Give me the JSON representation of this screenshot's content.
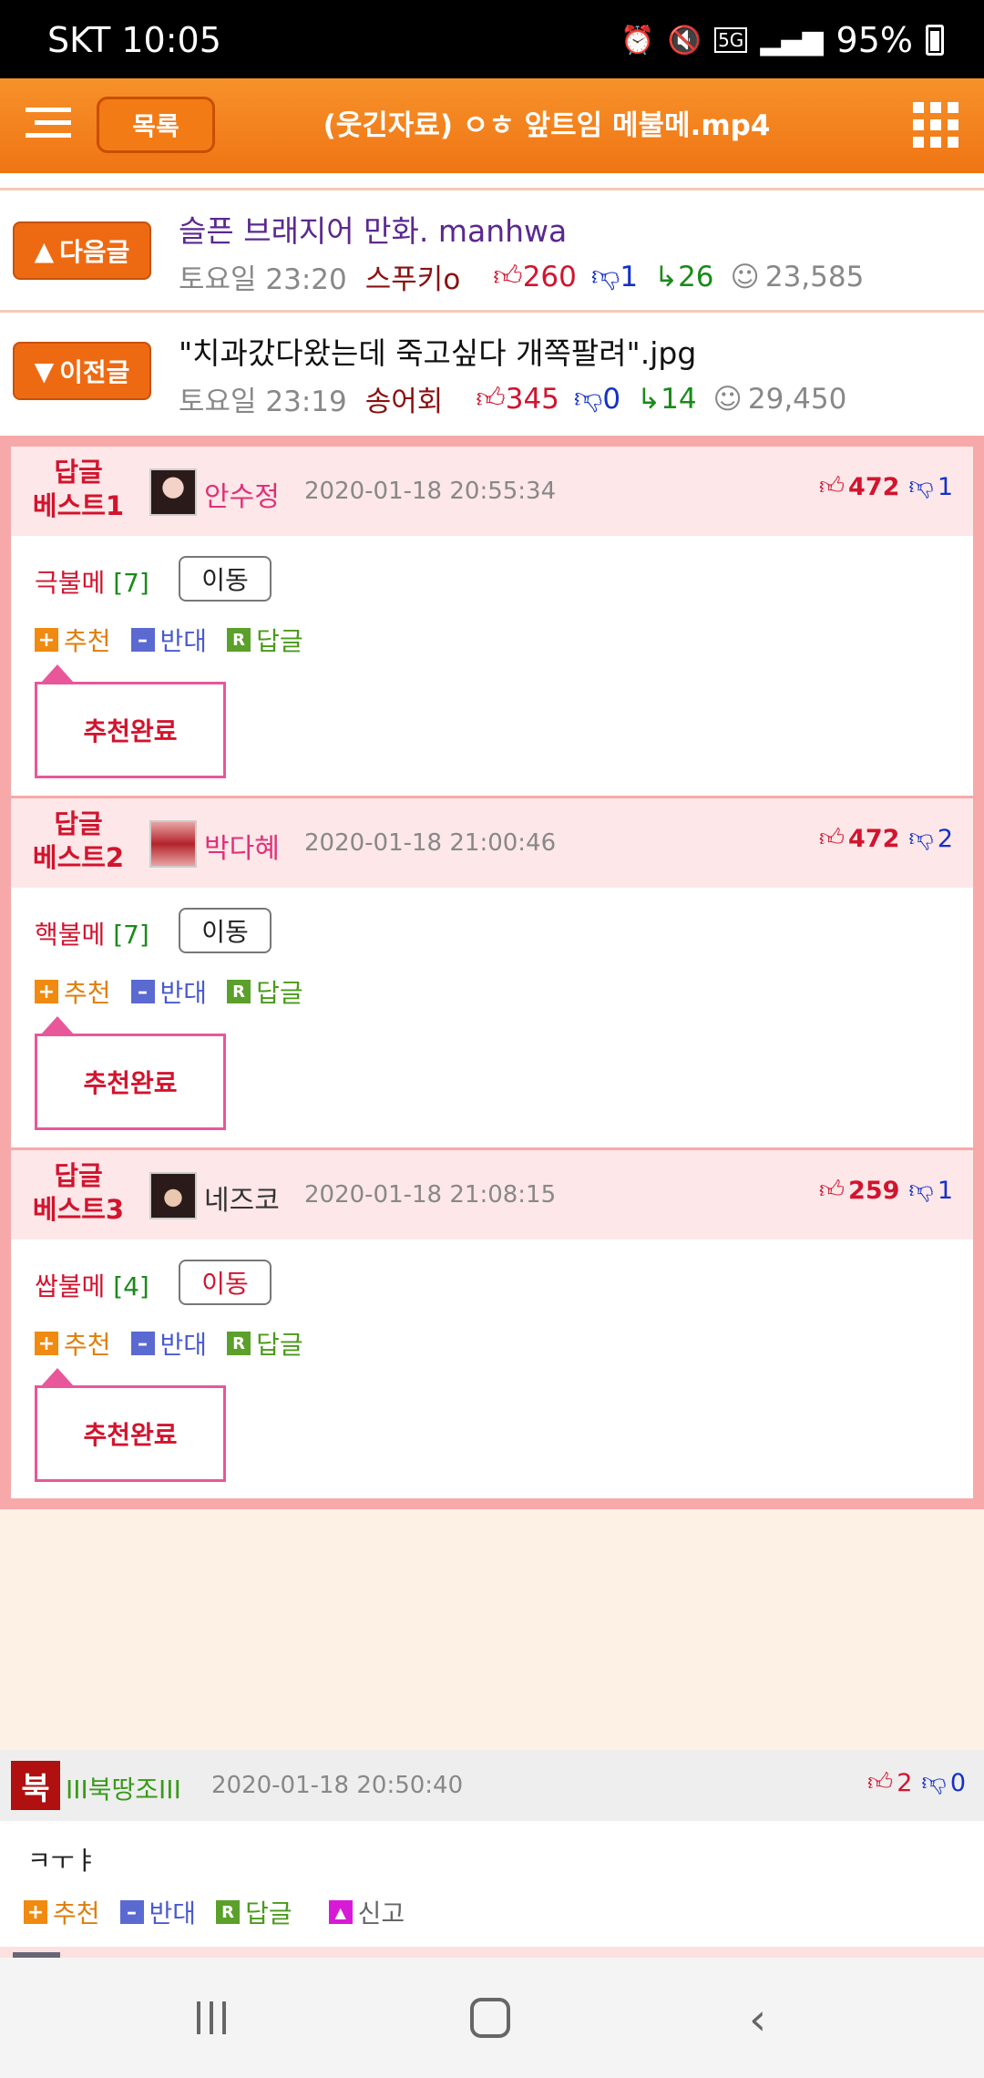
{
  "status_bar": {
    "carrier_time": "SKT 10:05",
    "battery": "95%",
    "network": "5G"
  },
  "header": {
    "list_button": "목록",
    "title": "(웃긴자료) ㅇㅎ 앞트임 메불메.mp4",
    "menu_icon": "hamburger-menu-icon",
    "grid_icon": "grid-apps-icon"
  },
  "nav": {
    "next": {
      "button": "다음글",
      "title": "슬픈 브래지어 만화. manhwa",
      "time": "토요일 23:20",
      "author": "스푸키o",
      "up": "260",
      "down": "1",
      "replies": "26",
      "views": "23,585"
    },
    "prev": {
      "button": "이전글",
      "title": "\"치과갔다왔는데 죽고싶다 개쪽팔려\".jpg",
      "time": "토요일 23:19",
      "author": "송어회",
      "up": "345",
      "down": "0",
      "replies": "14",
      "views": "29,450"
    }
  },
  "best_replies": [
    {
      "label_line1": "답글",
      "label_line2": "베스트1",
      "nick": "안수정",
      "date": "2020-01-18 20:55:34",
      "up": "472",
      "down": "1",
      "text": "극불메",
      "count": "[7]",
      "move": "이동",
      "done": "추천완료"
    },
    {
      "label_line1": "답글",
      "label_line2": "베스트2",
      "nick": "박다혜",
      "date": "2020-01-18 21:00:46",
      "up": "472",
      "down": "2",
      "text": "핵불메",
      "count": "[7]",
      "move": "이동",
      "done": "추천완료"
    },
    {
      "label_line1": "답글",
      "label_line2": "베스트3",
      "nick": "네즈코",
      "date": "2020-01-18 21:08:15",
      "up": "259",
      "down": "1",
      "text": "쌉불메",
      "count": "[4]",
      "move": "이동",
      "done": "추천완료"
    }
  ],
  "actions": {
    "recommend": "추천",
    "oppose": "반대",
    "reply": "답글",
    "report": "신고"
  },
  "reply": {
    "avatar_text": "북",
    "nick": "III북땅조III",
    "date": "2020-01-18 20:50:40",
    "up": "2",
    "down": "0",
    "text": "ㅋㅜㅑ"
  }
}
